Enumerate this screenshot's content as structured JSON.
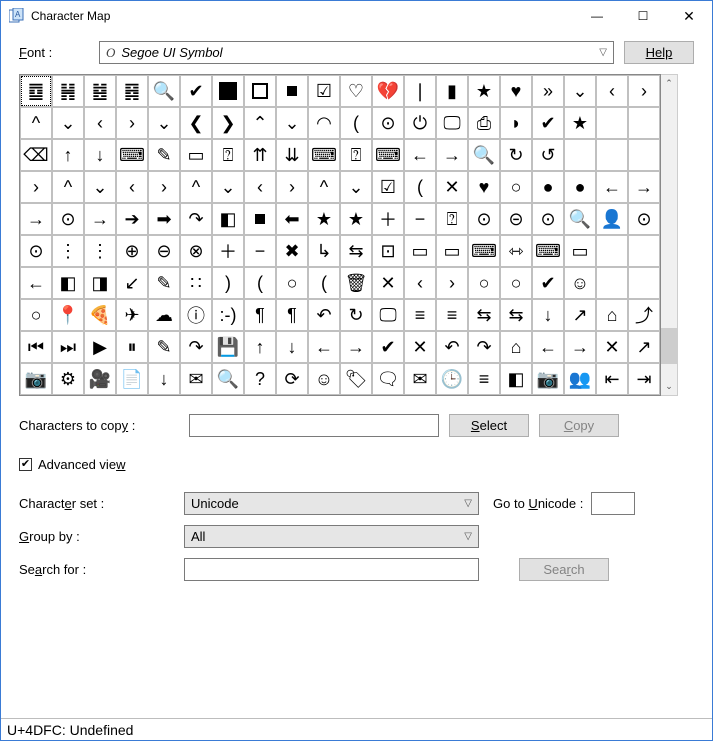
{
  "window": {
    "title": "Character Map",
    "min": "—",
    "max": "☐",
    "close": "✕"
  },
  "fontRow": {
    "label": "Font :",
    "fontName": "Segoe UI Symbol",
    "help": "Help"
  },
  "grid": {
    "rows": [
      [
        "䷼",
        "䷽",
        "䷾",
        "䷿",
        "🔍",
        "✔",
        "■",
        "□",
        "▪",
        "☑",
        "♡",
        "💔",
        "❘",
        "▮",
        "★",
        "♥",
        "»",
        "⌄",
        "‹",
        "›"
      ],
      [
        "^",
        "⌄",
        "‹",
        "›",
        "⌄",
        "❮",
        "❯",
        "⌃",
        "⌄",
        "◠",
        "(",
        "⊙",
        "⏻",
        "🖵",
        "⎙",
        "◗",
        "✔",
        "★"
      ],
      [
        "⌫",
        "↑",
        "↓",
        "⌨",
        "✎",
        "▭",
        "⍰",
        "⇈",
        "⇊",
        "⌨",
        "⍰",
        "⌨",
        "←",
        "→",
        "🔍",
        "↻",
        "↺"
      ],
      [
        "›",
        "^",
        "⌄",
        "‹",
        "›",
        "^",
        "⌄",
        "‹",
        "›",
        "^",
        "⌄",
        "☑",
        "(",
        "✕",
        "♥",
        "○",
        "●",
        "●",
        "←",
        "→"
      ],
      [
        "→",
        "⊙",
        "→",
        "➔",
        "➡",
        "↷",
        "◧",
        "▪",
        "⬅",
        "★",
        "★",
        "＋",
        "−",
        "⍰",
        "⊙",
        "⊝",
        "⊙",
        "🔍",
        "👤",
        "⊙"
      ],
      [
        "⊙",
        "⋮",
        "⋮",
        "⊕",
        "⊖",
        "⊗",
        "＋",
        "−",
        "✖",
        "↳",
        "⇆",
        "⊡",
        "▭",
        "▭",
        "⌨",
        "⇿",
        "⌨",
        "▭"
      ],
      [
        "←",
        "◧",
        "◨",
        "↙",
        "✎",
        "∷",
        ")",
        "(",
        "○",
        "(",
        "🗑",
        "✕",
        "‹",
        "›",
        "○",
        "○",
        "✔",
        "☺"
      ],
      [
        "○",
        "📍",
        "🍕",
        "✈",
        "☁",
        "ⓘ",
        ":-)",
        "¶",
        "¶",
        "↶",
        "↻",
        "🖵",
        "≡",
        "≡",
        "⇆",
        "⇆",
        "↓",
        "↗",
        "⌂",
        "⤴"
      ],
      [
        "⏮",
        "⏭",
        "▶",
        "⏸",
        "✎",
        "↷",
        "💾",
        "↑",
        "↓",
        "←",
        "→",
        "✔",
        "✕",
        "↶",
        "↷",
        "⌂",
        "←",
        "→",
        "✕",
        "↗"
      ],
      [
        "📷",
        "⚙",
        "🎥",
        "📄",
        "↓",
        "✉",
        "🔍",
        "?",
        "⟳",
        "☺",
        "🏷",
        "🗨",
        "✉",
        "🕒",
        "≡",
        "◧",
        "📷",
        "👥",
        "⇤",
        "⇥"
      ]
    ]
  },
  "copyRow": {
    "label": "Characters to copy :",
    "value": "",
    "select": "Select",
    "copy": "Copy"
  },
  "advanced": {
    "label": "Advanced view"
  },
  "charset": {
    "label": "Character set :",
    "value": "Unicode",
    "gotoLabel": "Go to Unicode :",
    "gotoValue": ""
  },
  "groupby": {
    "label": "Group by :",
    "value": "All"
  },
  "search": {
    "label": "Search for :",
    "value": "",
    "button": "Search"
  },
  "status": "U+4DFC: Undefined",
  "chart_data": null
}
